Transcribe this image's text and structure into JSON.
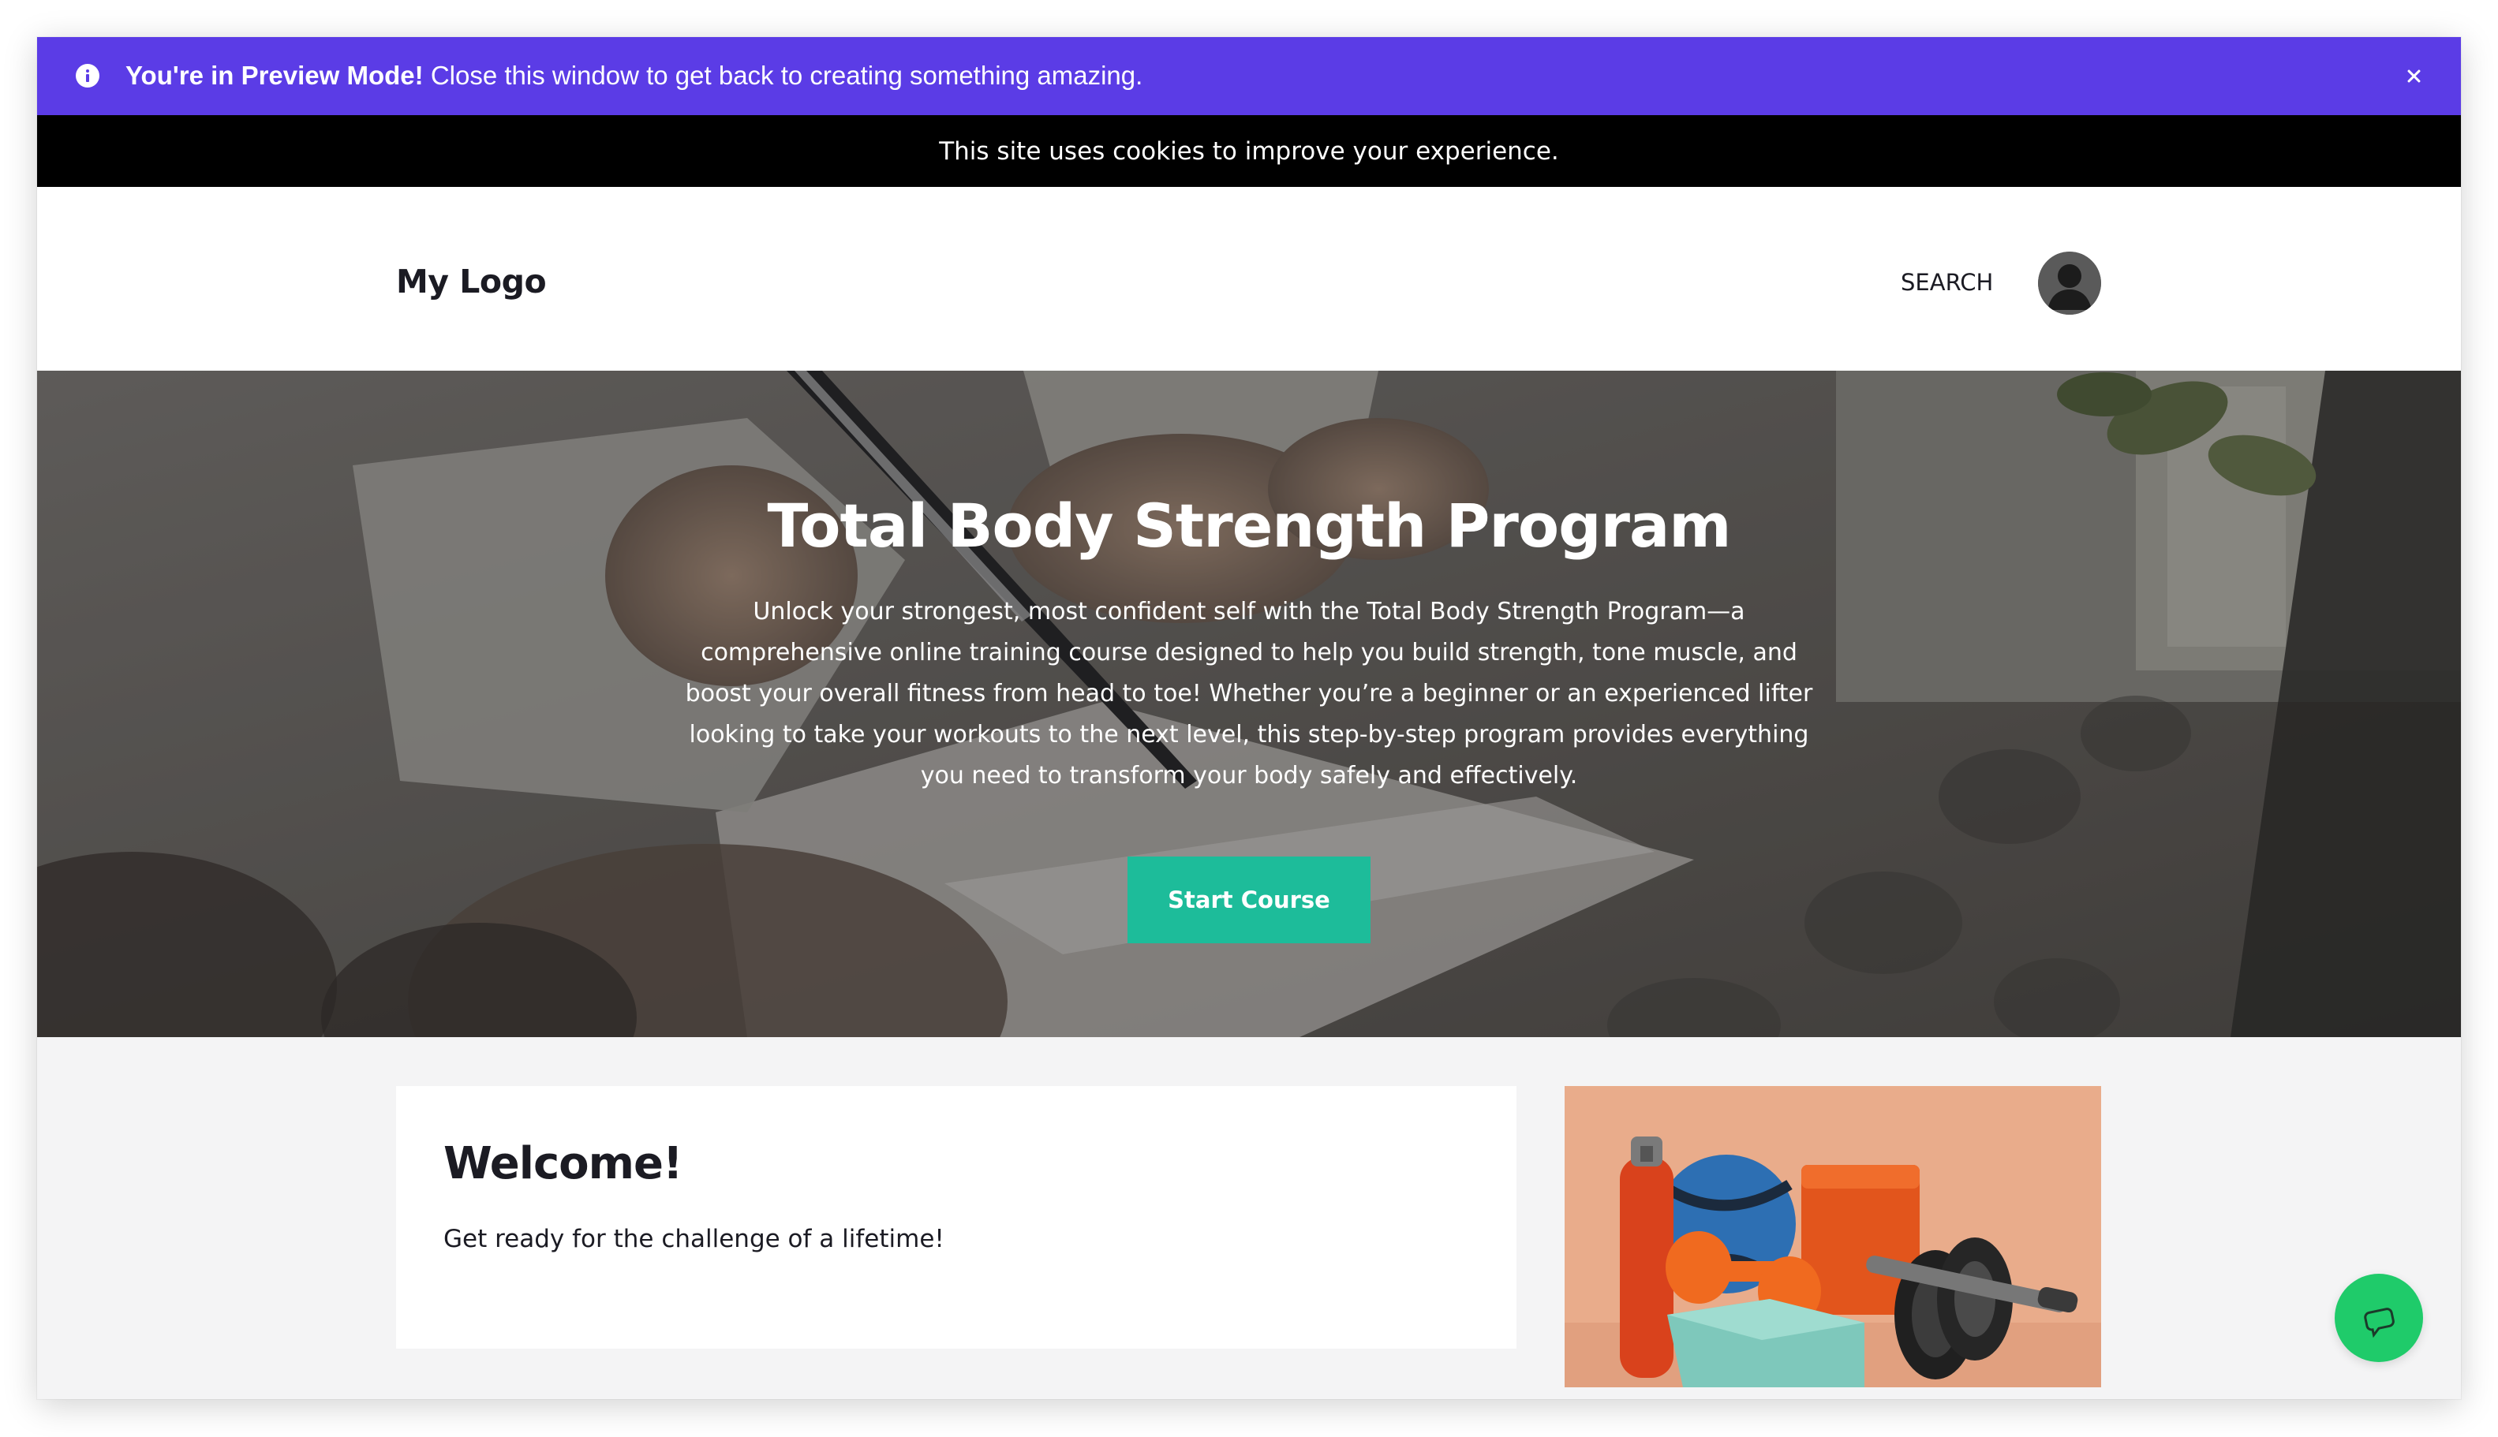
{
  "preview_banner": {
    "bold_text": "You're in Preview Mode!",
    "text": "Close this window to get back to creating something amazing.",
    "icon": "info-icon",
    "close_icon": "close-icon",
    "background": "#5b3ce6"
  },
  "cookie_notice": {
    "text": "This site uses cookies to improve your experience."
  },
  "header": {
    "logo": "My Logo",
    "search_label": "SEARCH",
    "avatar_icon": "user-avatar-icon"
  },
  "hero": {
    "title": "Total Body Strength Program",
    "description": "Unlock your strongest, most confident self with the Total Body Strength Program—a comprehensive online training course designed to help you build strength, tone muscle, and boost your overall fitness from head to toe! Whether you’re a beginner or an experienced lifter looking to take your workouts to the next level, this step-by-step program provides everything you need to transform your body safely and effectively.",
    "button_label": "Start Course",
    "button_color": "#1dbc9a"
  },
  "welcome": {
    "title": "Welcome!",
    "text": "Get ready for the challenge of a lifetime!"
  },
  "chat": {
    "icon": "chat-bubble-icon",
    "color": "#1fcb6a"
  }
}
